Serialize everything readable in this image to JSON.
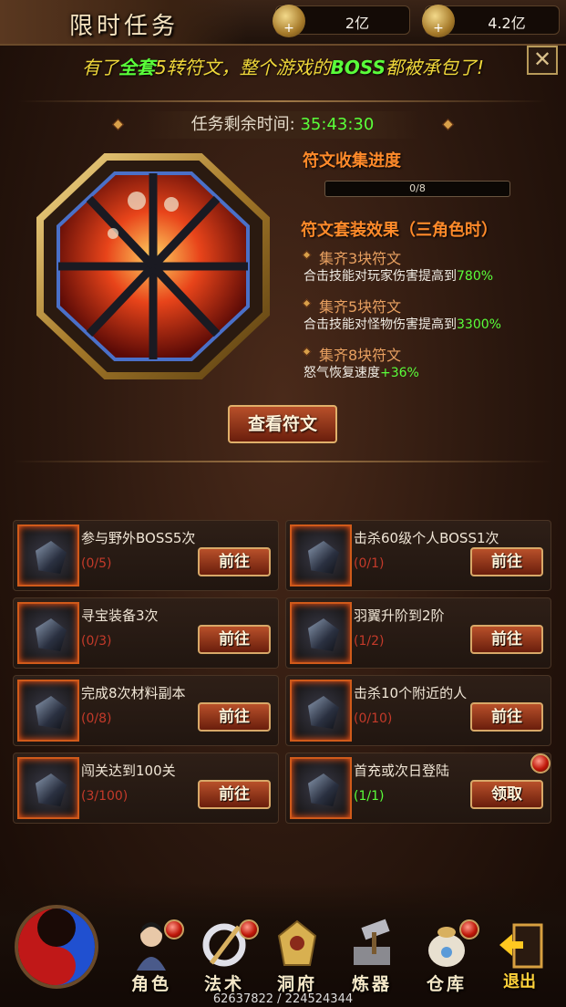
{
  "header": {
    "title": "限时任务",
    "currencies": [
      {
        "icon": "coin-icon",
        "value": "2亿"
      },
      {
        "icon": "ingot-icon",
        "value": "4.2亿"
      }
    ]
  },
  "slogan": {
    "part1": "有了",
    "highlight1": "全套",
    "part2": "5转符文，整个游戏的",
    "highlight2": "BOSS",
    "part3": "都被承包了!"
  },
  "timer": {
    "label": "任务剩余时间:",
    "value": "35:43:30"
  },
  "collection": {
    "title": "符文收集进度",
    "progress_text": "0/8",
    "progress_fraction": 0
  },
  "set_effects": {
    "title": "符文套装效果（三角色时）",
    "items": [
      {
        "name": "集齐3块符文",
        "desc": "合击技能对玩家伤害提高到",
        "value": "780%"
      },
      {
        "name": "集齐5块符文",
        "desc": "合击技能对怪物伤害提高到",
        "value": "3300%"
      },
      {
        "name": "集齐8块符文",
        "desc": "怒气恢复速度",
        "value": "+36%"
      }
    ]
  },
  "view_button": "查看符文",
  "tasks": [
    {
      "name": "参与野外BOSS5次",
      "progress": "(0/5)",
      "button": "前往",
      "done": false
    },
    {
      "name": "击杀60级个人BOSS1次",
      "progress": "(0/1)",
      "button": "前往",
      "done": false
    },
    {
      "name": "寻宝装备3次",
      "progress": "(0/3)",
      "button": "前往",
      "done": false
    },
    {
      "name": "羽翼升阶到2阶",
      "progress": "(1/2)",
      "button": "前往",
      "done": false
    },
    {
      "name": "完成8次材料副本",
      "progress": "(0/8)",
      "button": "前往",
      "done": false
    },
    {
      "name": "击杀10个附近的人",
      "progress": "(0/10)",
      "button": "前往",
      "done": false
    },
    {
      "name": "闯关达到100关",
      "progress": "(3/100)",
      "button": "前往",
      "done": false
    },
    {
      "name": "首充或次日登陆",
      "progress": "(1/1)",
      "button": "领取",
      "done": true
    }
  ],
  "nav": [
    {
      "label": "角色",
      "icon": "character-icon"
    },
    {
      "label": "法术",
      "icon": "spell-icon"
    },
    {
      "label": "洞府",
      "icon": "cave-icon"
    },
    {
      "label": "炼器",
      "icon": "forge-icon"
    },
    {
      "label": "仓库",
      "icon": "warehouse-icon"
    }
  ],
  "exit_label": "退出",
  "bottom_stat": "62637822 / 224524344",
  "colors": {
    "accent_green": "#5aff3a",
    "accent_orange": "#ff8a2a",
    "progress_red": "#c43a2a"
  }
}
